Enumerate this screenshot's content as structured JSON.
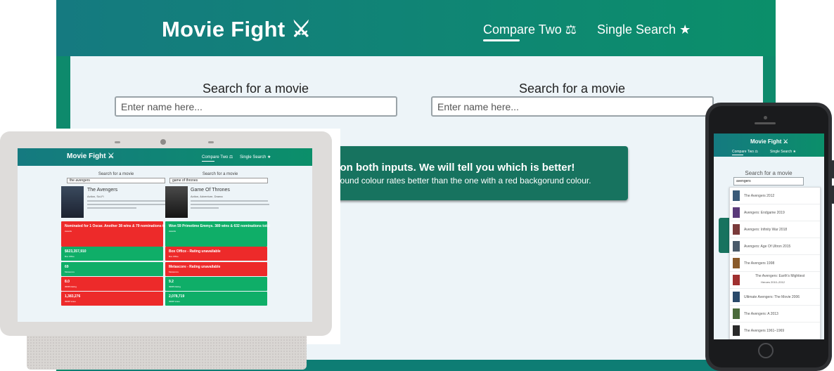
{
  "desktop": {
    "logo": "Movie Fight ⚔",
    "nav": [
      {
        "label": "Compare Two ⚖"
      },
      {
        "label": "Single Search ★"
      }
    ],
    "search_left": {
      "label": "Search for a movie",
      "placeholder": "Enter name here..."
    },
    "search_right": {
      "label": "Search for a movie",
      "placeholder": "Enter name here..."
    },
    "banner": {
      "title": "s on both inputs. We will tell you which is better!",
      "subtitle": "cgound colour rates better than the one with a red backgorund colour."
    }
  },
  "tablet": {
    "logo": "Movie Fight ⚔",
    "nav": [
      {
        "label": "Compare Two ⚖"
      },
      {
        "label": "Single Search ★"
      }
    ],
    "left": {
      "label": "Search for a movie",
      "input_value": "the avengers",
      "movie_title": "The Avengers",
      "movie_genre": "Action, Sci-Fi"
    },
    "right": {
      "label": "Search for a movie",
      "input_value": "game of thrones",
      "movie_title": "Game Of Thrones",
      "movie_genre": "Action, Adventure, Drama"
    },
    "stats": [
      {
        "left": {
          "value": "Nominated for 1 Oscar. Another 38 wins & 79 nominations total",
          "key": "Awards",
          "color": "#ed2a2a"
        },
        "right": {
          "value": "Won 59 Primetime Emmys. 389 wins & 632 nominations total",
          "key": "Awards",
          "color": "#0fae68"
        }
      },
      {
        "left": {
          "value": "$623,357,910",
          "key": "Box Office",
          "color": "#0fae68"
        },
        "right": {
          "value": "Box Office - Rating unavailable",
          "key": "Box Office",
          "color": "#ed2a2a"
        }
      },
      {
        "left": {
          "value": "69",
          "key": "Metascore",
          "color": "#0fae68"
        },
        "right": {
          "value": "Metascore - Rating unavailable",
          "key": "Metascore",
          "color": "#ed2a2a"
        }
      },
      {
        "left": {
          "value": "8.0",
          "key": "IMDB Rating",
          "color": "#ed2a2a"
        },
        "right": {
          "value": "9.2",
          "key": "IMDB Rating",
          "color": "#0fae68"
        }
      },
      {
        "left": {
          "value": "1,383,276",
          "key": "IMDB Votes",
          "color": "#ed2a2a"
        },
        "right": {
          "value": "2,078,719",
          "key": "IMDB Votes",
          "color": "#0fae68"
        }
      }
    ]
  },
  "phone": {
    "logo": "Movie Fight ⚔",
    "nav": [
      {
        "label": "Compare Two ⚖"
      },
      {
        "label": "Single Search ★"
      }
    ],
    "search": {
      "label": "Search for a movie",
      "input_value": "avengers"
    },
    "results": [
      {
        "title": "The Avengers 2012",
        "thumb_color": "#3a5a78"
      },
      {
        "title": "Avengers: Endgame 2019",
        "thumb_color": "#5b3a7a"
      },
      {
        "title": "Avengers: Infinity War 2018",
        "thumb_color": "#7a3a3a"
      },
      {
        "title": "Avengers: Age Of Ultron 2015",
        "thumb_color": "#4a5a6a"
      },
      {
        "title": "The Avengers 1998",
        "thumb_color": "#8a5a2a"
      },
      {
        "title": "The Avengers: Earth's Mightiest",
        "subtitle": "Heroes 2010–2012",
        "thumb_color": "#a03030"
      },
      {
        "title": "Ultimate Avengers: The Movie 2006",
        "thumb_color": "#2a4a6a"
      },
      {
        "title": "The Avengers: A 2013",
        "thumb_color": "#4a6a3a"
      },
      {
        "title": "The Avengers 1961–1969",
        "thumb_color": "#2a2a2a"
      }
    ]
  }
}
